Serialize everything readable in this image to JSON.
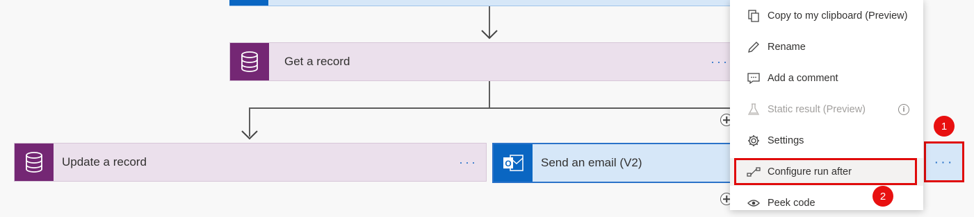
{
  "flow": {
    "get_record": {
      "title": "Get a record",
      "more": "···"
    },
    "update_record": {
      "title": "Update a record",
      "more": "···"
    },
    "send_email": {
      "title": "Send an email (V2)"
    },
    "ellipsis_button": "···"
  },
  "context_menu": {
    "items": [
      {
        "label": "Copy to my clipboard (Preview)",
        "icon": "copy-icon"
      },
      {
        "label": "Rename",
        "icon": "pencil-icon"
      },
      {
        "label": "Add a comment",
        "icon": "comment-icon"
      },
      {
        "label": "Static result (Preview)",
        "icon": "flask-icon",
        "disabled": true,
        "info_icon": "info-icon"
      },
      {
        "label": "Settings",
        "icon": "gear-icon"
      },
      {
        "label": "Configure run after",
        "icon": "run-after-icon"
      },
      {
        "label": "Peek code",
        "icon": "eye-icon"
      }
    ]
  },
  "annotations": {
    "badge1": "1",
    "badge2": "2"
  },
  "colors": {
    "dataverse_purple": "#742774",
    "dataverse_card": "#ebe0ec",
    "outlook_blue": "#0a66c2",
    "email_card": "#d6e7f8",
    "annotation_red": "#e00b0b"
  }
}
